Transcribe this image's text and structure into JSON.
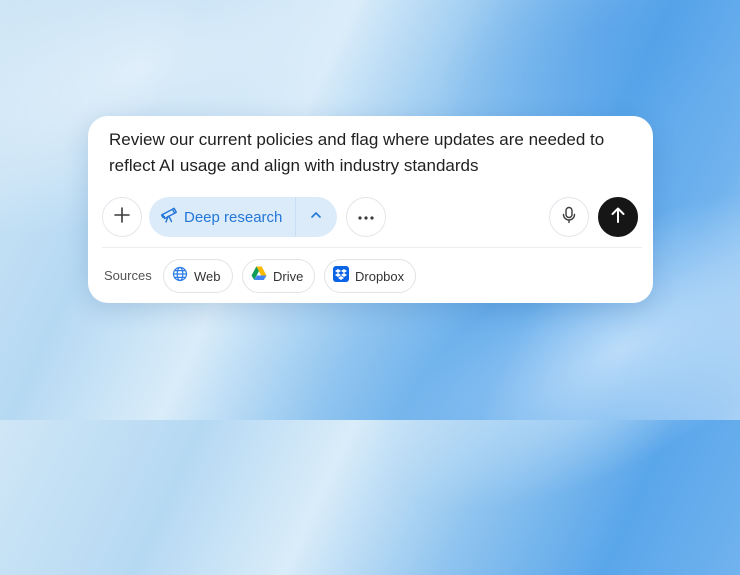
{
  "prompt": {
    "text": "Review our current policies and flag where updates are needed to reflect AI usage and align with industry standards"
  },
  "toolbar": {
    "add_icon": "plus-icon",
    "mode": {
      "label": "Deep research",
      "icon": "telescope-icon",
      "toggle_icon": "chevron-up-icon",
      "accent": "#2477d6",
      "background": "#dcebfa"
    },
    "more_icon": "ellipsis-icon",
    "mic_icon": "microphone-icon",
    "send_icon": "arrow-up-icon",
    "send_background": "#161616"
  },
  "sources": {
    "label": "Sources",
    "items": [
      {
        "label": "Web",
        "icon": "globe-icon"
      },
      {
        "label": "Drive",
        "icon": "google-drive-icon"
      },
      {
        "label": "Dropbox",
        "icon": "dropbox-icon"
      }
    ]
  }
}
